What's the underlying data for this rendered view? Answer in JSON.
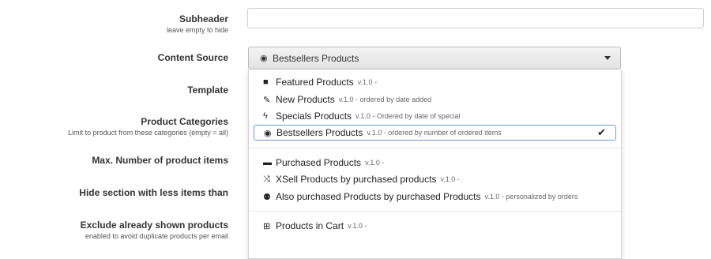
{
  "form": {
    "subheader": {
      "label": "Subheader",
      "help": "leave empty to hide",
      "value": "",
      "placeholder": ""
    },
    "content_source": {
      "label": "Content Source",
      "selected": "Bestsellers Products",
      "selected_icon": "◉"
    },
    "template": {
      "label": "Template"
    },
    "product_categories": {
      "label": "Product Categories",
      "help": "Limit to product from these categories (empty = all)"
    },
    "max_items": {
      "label": "Max. Number of product items"
    },
    "hide_section": {
      "label": "Hide section with less items than"
    },
    "exclude_shown": {
      "label": "Exclude already shown products",
      "help": "enabled to avoid duplicate products per email"
    }
  },
  "dropdown": {
    "options": [
      {
        "icon": "bookmark-icon",
        "glyph": "■",
        "name": "Featured Products",
        "meta": "v.1.0 -"
      },
      {
        "icon": "pen-new-icon",
        "glyph": "✎",
        "name": "New Products",
        "meta": "v.1.0 - ordered by date added"
      },
      {
        "icon": "bolt-icon",
        "glyph": "ϟ",
        "name": "Specials Products",
        "meta": "v.1.0 - Ordered by date of special"
      },
      {
        "icon": "bullseye-icon",
        "glyph": "◉",
        "name": "Bestsellers Products",
        "meta": "v.1.0 - ordered by number of ordered items",
        "check": "✔"
      },
      {
        "icon": "cart-icon",
        "glyph": "▬",
        "name": "Purchased Products",
        "meta": "v.1.0 -"
      },
      {
        "icon": "shuffle-icon",
        "glyph": "⤨",
        "name": "XSell Products by purchased products",
        "meta": "v.1.0 -"
      },
      {
        "icon": "users-icon",
        "glyph": "⚉",
        "name": "Also purchased Products by purchased Products",
        "meta": "v.1.0 - personalized by orders"
      },
      {
        "icon": "basket-icon",
        "glyph": "⊞",
        "name": "Products in Cart",
        "meta": "v.1.0 -"
      }
    ]
  }
}
